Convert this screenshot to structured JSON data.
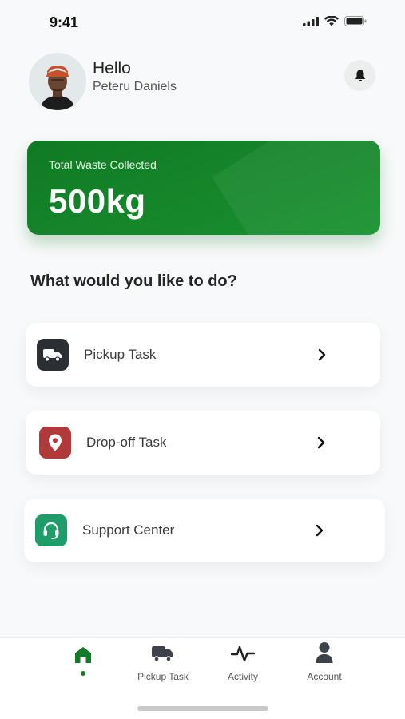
{
  "status_bar": {
    "time": "9:41"
  },
  "header": {
    "greeting": "Hello",
    "user_name": "Peteru Daniels"
  },
  "summary": {
    "label": "Total Waste Collected",
    "value": "500kg"
  },
  "section_title": "What would you like to do?",
  "actions": [
    {
      "label": "Pickup Task",
      "icon": "truck-icon",
      "color": "#2b2f33"
    },
    {
      "label": "Drop-off Task",
      "icon": "location-pin-icon",
      "color": "#b03a3a"
    },
    {
      "label": "Support Center",
      "icon": "headset-icon",
      "color": "#1e9c69"
    }
  ],
  "tab_bar": {
    "items": [
      {
        "label": "",
        "icon": "home-icon",
        "active": true
      },
      {
        "label": "Pickup Task",
        "icon": "truck-icon",
        "active": false
      },
      {
        "label": "Activity",
        "icon": "activity-icon",
        "active": false
      },
      {
        "label": "Account",
        "icon": "user-icon",
        "active": false
      }
    ]
  },
  "colors": {
    "brand_green": "#137a25",
    "background": "#f8f9fa"
  }
}
